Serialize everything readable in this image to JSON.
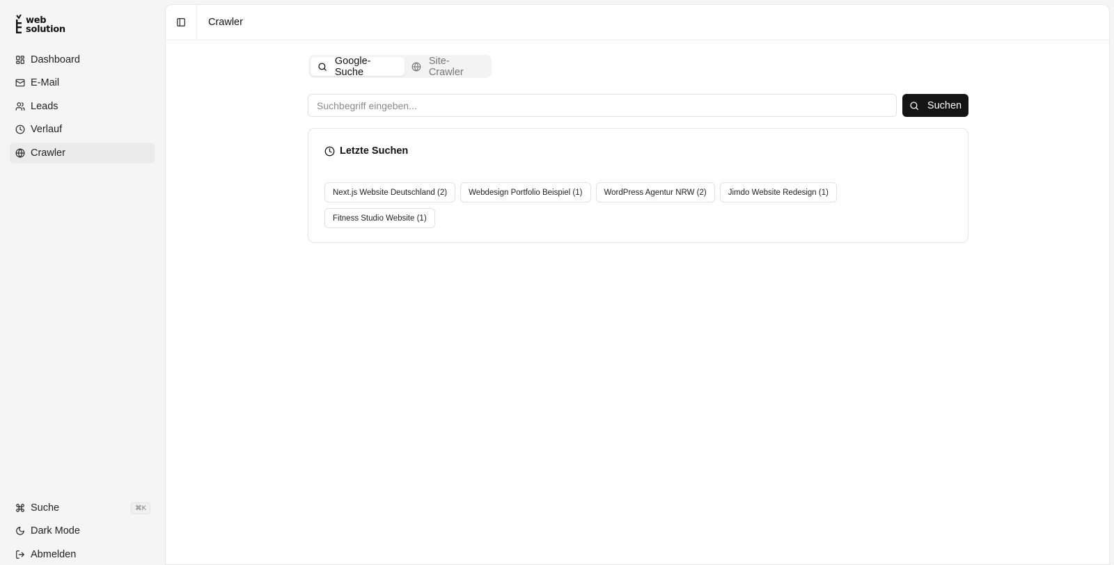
{
  "brand": {
    "line1": "web",
    "line2": "solution"
  },
  "sidebar": {
    "items": [
      {
        "label": "Dashboard",
        "icon": "dashboard-icon"
      },
      {
        "label": "E-Mail",
        "icon": "mail-icon"
      },
      {
        "label": "Leads",
        "icon": "users-icon"
      },
      {
        "label": "Verlauf",
        "icon": "clock-icon"
      },
      {
        "label": "Crawler",
        "icon": "globe-icon",
        "active": true
      }
    ],
    "bottom": [
      {
        "label": "Suche",
        "icon": "command-icon",
        "shortcut": "⌘K"
      },
      {
        "label": "Dark Mode",
        "icon": "moon-icon"
      },
      {
        "label": "Abmelden",
        "icon": "logout-icon"
      }
    ]
  },
  "header": {
    "title": "Crawler"
  },
  "tabs": [
    {
      "label": "Google-Suche",
      "icon": "search-icon",
      "active": true
    },
    {
      "label": "Site-Crawler",
      "icon": "globe-icon",
      "active": false
    }
  ],
  "search": {
    "placeholder": "Suchbegriff eingeben...",
    "value": "",
    "button_label": "Suchen"
  },
  "recent": {
    "title": "Letzte Suchen",
    "chips": [
      "Next.js Website Deutschland (2)",
      "Webdesign Portfolio Beispiel (1)",
      "WordPress Agentur NRW (2)",
      "Jimdo Website Redesign (1)",
      "Fitness Studio Website (1)"
    ]
  },
  "colors": {
    "primary_button": "#141414",
    "background": "#f5f5f5",
    "panel": "#ffffff"
  }
}
